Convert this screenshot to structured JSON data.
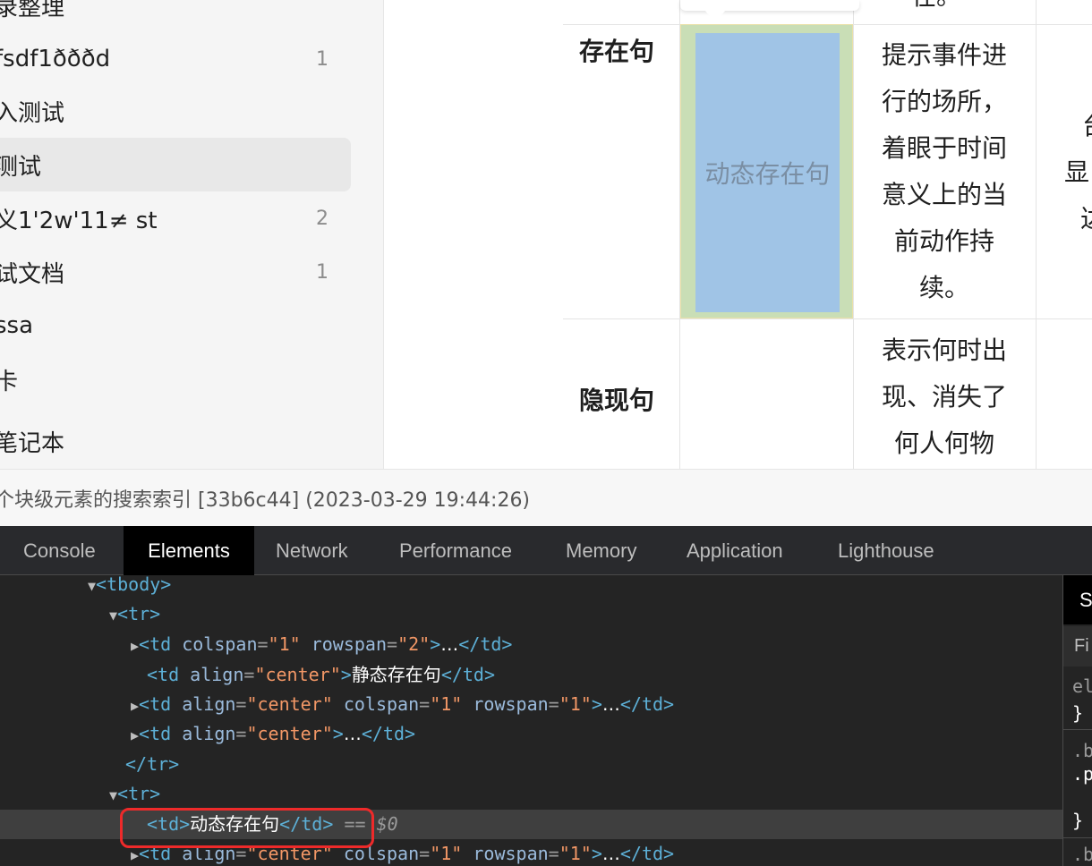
{
  "sidebar": {
    "items": [
      {
        "label": "录整理",
        "count": ""
      },
      {
        "label": "fsdf1ðððd",
        "count": "1"
      },
      {
        "label": "入测试",
        "count": ""
      },
      {
        "label": "测试",
        "count": ""
      },
      {
        "label": "义1'2w'11≠ st",
        "count": "2"
      },
      {
        "label": "试文档",
        "count": "1"
      },
      {
        "label": "ssa",
        "count": ""
      },
      {
        "label": "卡",
        "count": ""
      },
      {
        "label": "笔记本",
        "count": ""
      }
    ]
  },
  "doc_table": {
    "row1_head": "存在句",
    "row2_head": "隐现句",
    "selected_cell": "动态存在句",
    "row1_desc": [
      "提示事件进",
      "行的场所，",
      "着眼于时间",
      "意义上的当",
      "前动作持",
      "续。"
    ],
    "row2_desc": [
      "表示何时出",
      "现、消失了",
      "何人何物"
    ],
    "top_clip": "在。",
    "right_clip": [
      "台",
      "显",
      "达"
    ]
  },
  "statusbar": {
    "text": "个块级元素的搜索索引 [33b6c44] (2023-03-29 19:44:26)"
  },
  "devtools": {
    "tabs": [
      "Console",
      "Elements",
      "Network",
      "Performance",
      "Memory",
      "Application",
      "Lighthouse"
    ],
    "active_tab": "Elements",
    "dom": {
      "tbody_open": "<tbody>",
      "tr_open": "<tr>",
      "tr_close": "</tr>",
      "td_open": "<td",
      "td_close": "</td>",
      "td_plain_open": "<td>",
      "gt": ">",
      "ellipsis": "…",
      "a_colspan": "colspan",
      "a_rowspan": "rowspan",
      "a_align": "align",
      "v_1": "\"1\"",
      "v_2": "\"2\"",
      "v_center": "\"center\"",
      "eq": "=",
      "text_static": "静态存在句",
      "text_dynamic": "动态存在句",
      "eq_marker": "==",
      "ref": "$0"
    },
    "styles_pane": {
      "header": "S",
      "filter": "Fi",
      "lines": [
        "el",
        "}",
        ".b",
        ".p",
        "}",
        ".b"
      ]
    }
  }
}
